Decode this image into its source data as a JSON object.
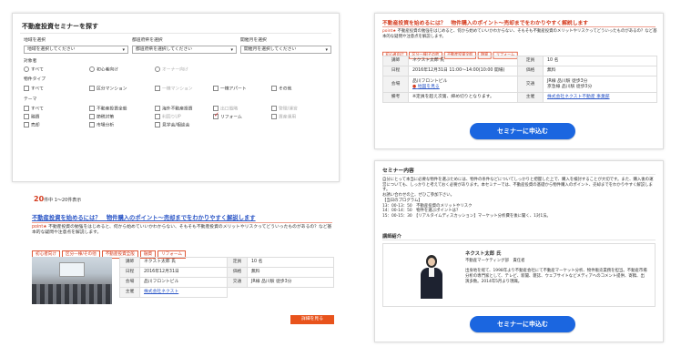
{
  "search": {
    "title": "不動産投資セミナーを探す",
    "area_label": "地域を選択",
    "area_value": "地域を選択してください",
    "pref_label": "都道府県を選択",
    "pref_value": "都道府県を選択してください",
    "date_label": "開催月を選択",
    "date_value": "開催月を選択してください",
    "target_label": "対象者",
    "target_options": [
      "すべて",
      "初心者向け",
      "オーナー向け"
    ],
    "type_label": "物件タイプ",
    "type_options": [
      "すべて",
      "区分マンション",
      "一棟マンション",
      "一棟アパート",
      "その他"
    ],
    "theme_label": "テーマ",
    "theme_row1": [
      "すべて",
      "不動産投資全般",
      "海外不動産投資",
      "出口戦略",
      "管理/運営"
    ],
    "theme_row2": [
      "融資",
      "節税対策",
      "利回りUP",
      "リフォーム",
      "資産運用"
    ],
    "theme_row3": [
      "売却",
      "市場分析",
      "見学会/相談会"
    ]
  },
  "results": {
    "count": "20",
    "count_suffix": "件中 1〜20件表示"
  },
  "seminar": {
    "title": "不動産投資を始めるには？　物件購入のポイント〜売却までをわかりやすく解説します",
    "point_label": "point★",
    "point_text": "不動産投資の勉強をはじめると、何から始めていいかわからない、そもそも不動産投資のメリットやリスクってどういったものがあるの？など基本的な疑問や注意点を解説します。",
    "tags": [
      "初心者向け",
      "区分一棟/その他",
      "不動産投資全般",
      "融資",
      "リフォーム"
    ],
    "instructor_label": "講師",
    "instructor": "ネクスト太郎 氏",
    "capacity_label": "定員",
    "capacity": "10 名",
    "date_label": "日程",
    "date": "2016年12月31日",
    "date_full": "2016年12月31日 11:00〜14:00(10:00 開場)",
    "fee_label": "価格",
    "fee": "無料",
    "venue_label": "会場",
    "venue": "品川フロントビル",
    "venue_map": "地図を見る",
    "access_label": "交通",
    "access": "JR線 品川駅 徒歩3分",
    "access2": "京急線 品川駅 徒歩3分",
    "organizer_label": "主催",
    "organizer": "株式会社ネクスト",
    "organizer_full": "株式会社ネクスト不動産 事業部",
    "belongings_label": "備考",
    "belongings": "※定員を超え次第、締め切りとなります。",
    "detail_button": "詳細を見る",
    "apply_button": "セミナーに申込む"
  },
  "content": {
    "title": "セミナー内容",
    "body": "自分にとって本当に必要な物件を選ぶためには、物件の条件などについてしっかりと把握した上で、購入を検討することが大切です。また、購入後の運営についても、しっかりと考えておく必要があります。本セミナーでは、不動産投資の基礎から物件購入のポイント、売却までをわかりやすく解説します。",
    "closing": "お誘い合わせの上、ぜひご参加下さい。",
    "program_label": "【当日のプログラム】",
    "program": [
      "13：00-13：50　不動産投資のメリットやリスク",
      "14：00-14：50　物件を選ぶポイントは？",
      "15：00-15：30　【リアルタイムディスカッション】マーケット分析費を後に聞く、1対1法。"
    ],
    "intro_title": "講師紹介",
    "instructor_name": "ネクスト太郎 氏",
    "instructor_role": "不動産マーケティング部　責任者",
    "instructor_bio": "出身地を経て、1998年より不動産会社にて不動産マーケット分析、物件販売業務を担当。不動産市場分析の専門家として、テレビ、新聞、雑誌、ウェブサイトなどメディアへのコメント提供、寄稿、出演多数。2014年5月より現職。"
  },
  "colors": {
    "accent_red": "#d43b1e",
    "link_blue": "#2a55c6",
    "apply_blue": "#1b66e0",
    "detail_orange": "#e8531c"
  }
}
